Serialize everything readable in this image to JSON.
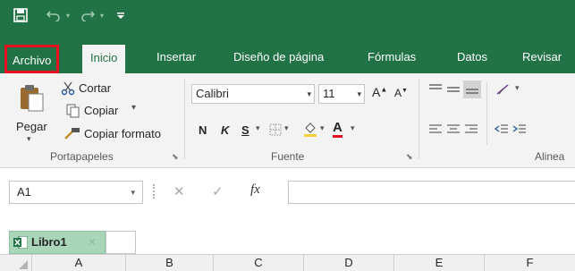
{
  "quick_access": {
    "save_icon": "save-icon",
    "undo_icon": "undo-icon",
    "redo_icon": "redo-icon",
    "customize_icon": "customize-qat-icon"
  },
  "tabs": [
    {
      "label": "Archivo"
    },
    {
      "label": "Inicio"
    },
    {
      "label": "Insertar"
    },
    {
      "label": "Diseño de página"
    },
    {
      "label": "Fórmulas"
    },
    {
      "label": "Datos"
    },
    {
      "label": "Revisar"
    }
  ],
  "ribbon": {
    "clipboard": {
      "label": "Portapapeles",
      "paste": "Pegar",
      "cut": "Cortar",
      "copy": "Copiar",
      "format_painter": "Copiar formato"
    },
    "font": {
      "label": "Fuente",
      "font_name": "Calibri",
      "font_size": "11",
      "bold": "N",
      "italic": "K",
      "underline": "S",
      "increase_size": "A",
      "decrease_size": "A",
      "font_color_letter": "A"
    },
    "alignment": {
      "label": "Alinea"
    }
  },
  "formula_bar": {
    "name_box": "A1",
    "cancel": "✕",
    "enter": "✓",
    "fx": "fx"
  },
  "workbook": {
    "tab_label": "Libro1",
    "close": "×"
  },
  "columns": [
    "A",
    "B",
    "C",
    "D",
    "E",
    "F"
  ],
  "colors": {
    "accent": "#217346",
    "highlight": "#e81123"
  }
}
